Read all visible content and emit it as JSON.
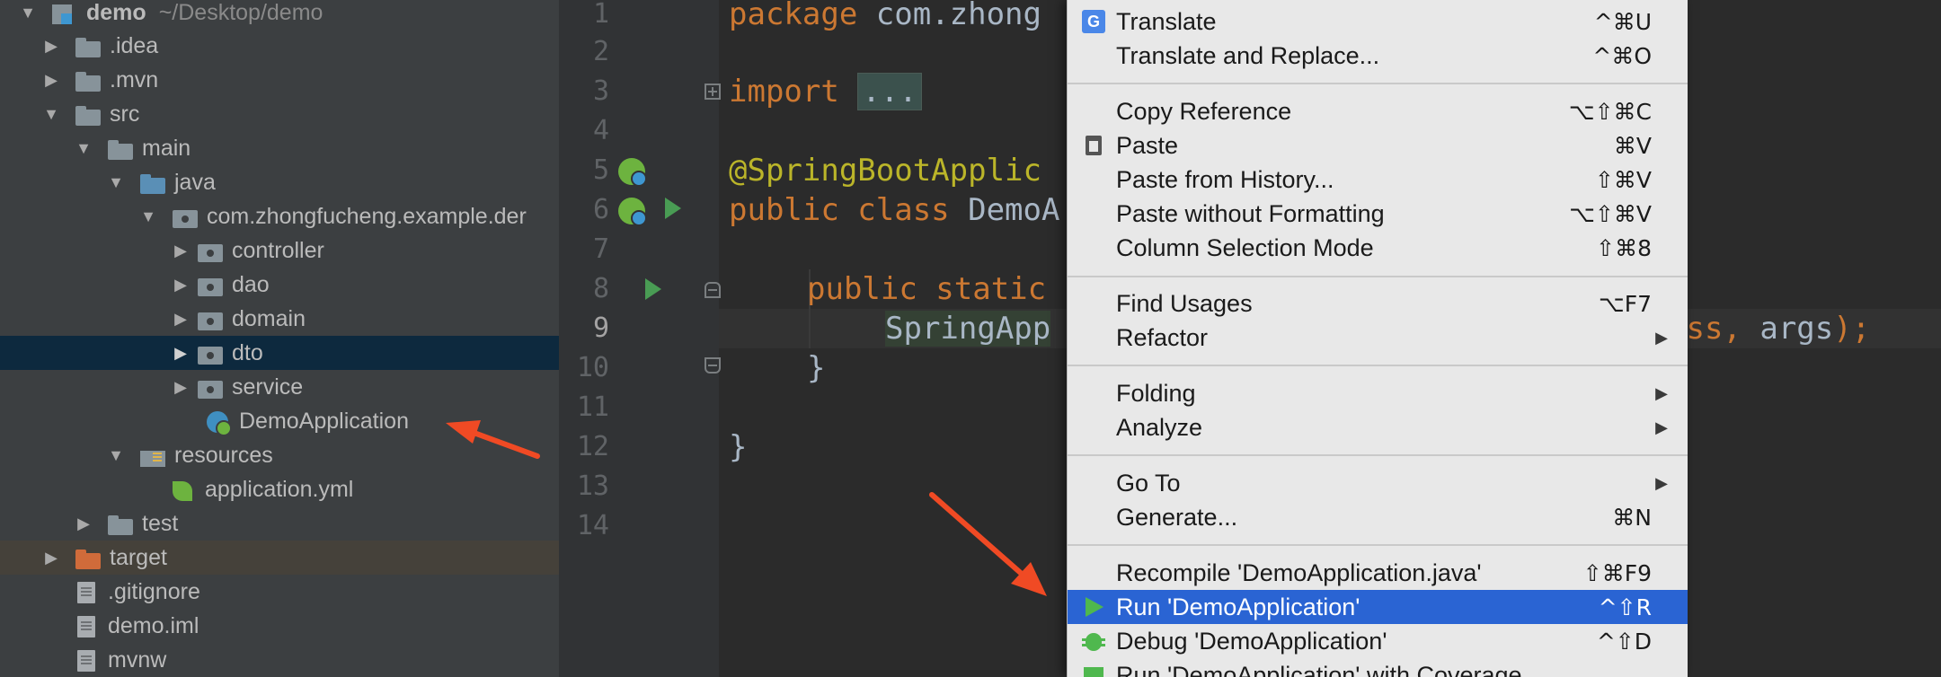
{
  "project_tree": {
    "rows": [
      {
        "label": "demo",
        "path": "~/Desktop/demo"
      },
      {
        "label": ".idea"
      },
      {
        "label": ".mvn"
      },
      {
        "label": "src"
      },
      {
        "label": "main"
      },
      {
        "label": "java"
      },
      {
        "label": "com.zhongfucheng.example.der"
      },
      {
        "label": "controller"
      },
      {
        "label": "dao"
      },
      {
        "label": "domain"
      },
      {
        "label": "dto"
      },
      {
        "label": "service"
      },
      {
        "label": "DemoApplication"
      },
      {
        "label": "resources"
      },
      {
        "label": "application.yml"
      },
      {
        "label": "test"
      },
      {
        "label": "target"
      },
      {
        "label": ".gitignore"
      },
      {
        "label": "demo.iml"
      },
      {
        "label": "mvnw"
      }
    ],
    "selected_row": "dto"
  },
  "editor": {
    "line_numbers": [
      "1",
      "2",
      "3",
      "4",
      "5",
      "6",
      "7",
      "8",
      "9",
      "10",
      "11",
      "12",
      "13",
      "14"
    ],
    "current_line": "10",
    "code": {
      "l1_kw": "package",
      "l1_rest": " com.zhong",
      "l3_kw": "import",
      "l3_fold": "...",
      "l6_ann": "@SpringBootApplic",
      "l7_kw": "public class",
      "l7_rest": " DemoA",
      "l9_kw": "public static",
      "l10_call": "SpringApp",
      "l10_tail_kw": "ass,",
      "l10_tail_plain": " args",
      "l10_tail_end": ");",
      "l11_brace": "}",
      "l13_brace": "}"
    }
  },
  "context_menu": {
    "items": [
      {
        "label": "Translate",
        "shortcut": "^⌘U",
        "icon": "google-translate-icon"
      },
      {
        "label": "Translate and Replace...",
        "shortcut": "^⌘O"
      },
      {
        "label": "Copy Reference",
        "shortcut": "⌥⇧⌘C"
      },
      {
        "label": "Paste",
        "shortcut": "⌘V",
        "icon": "paste-icon"
      },
      {
        "label": "Paste from History...",
        "shortcut": "⇧⌘V"
      },
      {
        "label": "Paste without Formatting",
        "shortcut": "⌥⇧⌘V"
      },
      {
        "label": "Column Selection Mode",
        "shortcut": "⇧⌘8"
      },
      {
        "label": "Find Usages",
        "shortcut": "⌥F7"
      },
      {
        "label": "Refactor",
        "submenu": "▶"
      },
      {
        "label": "Folding",
        "submenu": "▶"
      },
      {
        "label": "Analyze",
        "submenu": "▶"
      },
      {
        "label": "Go To",
        "submenu": "▶"
      },
      {
        "label": "Generate...",
        "shortcut": "⌘N"
      },
      {
        "label": "Recompile 'DemoApplication.java'",
        "shortcut": "⇧⌘F9"
      },
      {
        "label": "Run 'DemoApplication'",
        "shortcut": "^⇧R",
        "icon": "run-icon"
      },
      {
        "label": "Debug 'DemoApplication'",
        "shortcut": "^⇧D",
        "icon": "debug-icon"
      },
      {
        "label": "Run 'DemoApplication' with Coverage",
        "icon": "coverage-icon"
      }
    ],
    "highlighted_item": "Run 'DemoApplication'",
    "colors": {
      "highlight": "#2a64d3",
      "background": "#e8e8e8"
    }
  },
  "annotations": {
    "arrow_color": "#f04a24"
  }
}
